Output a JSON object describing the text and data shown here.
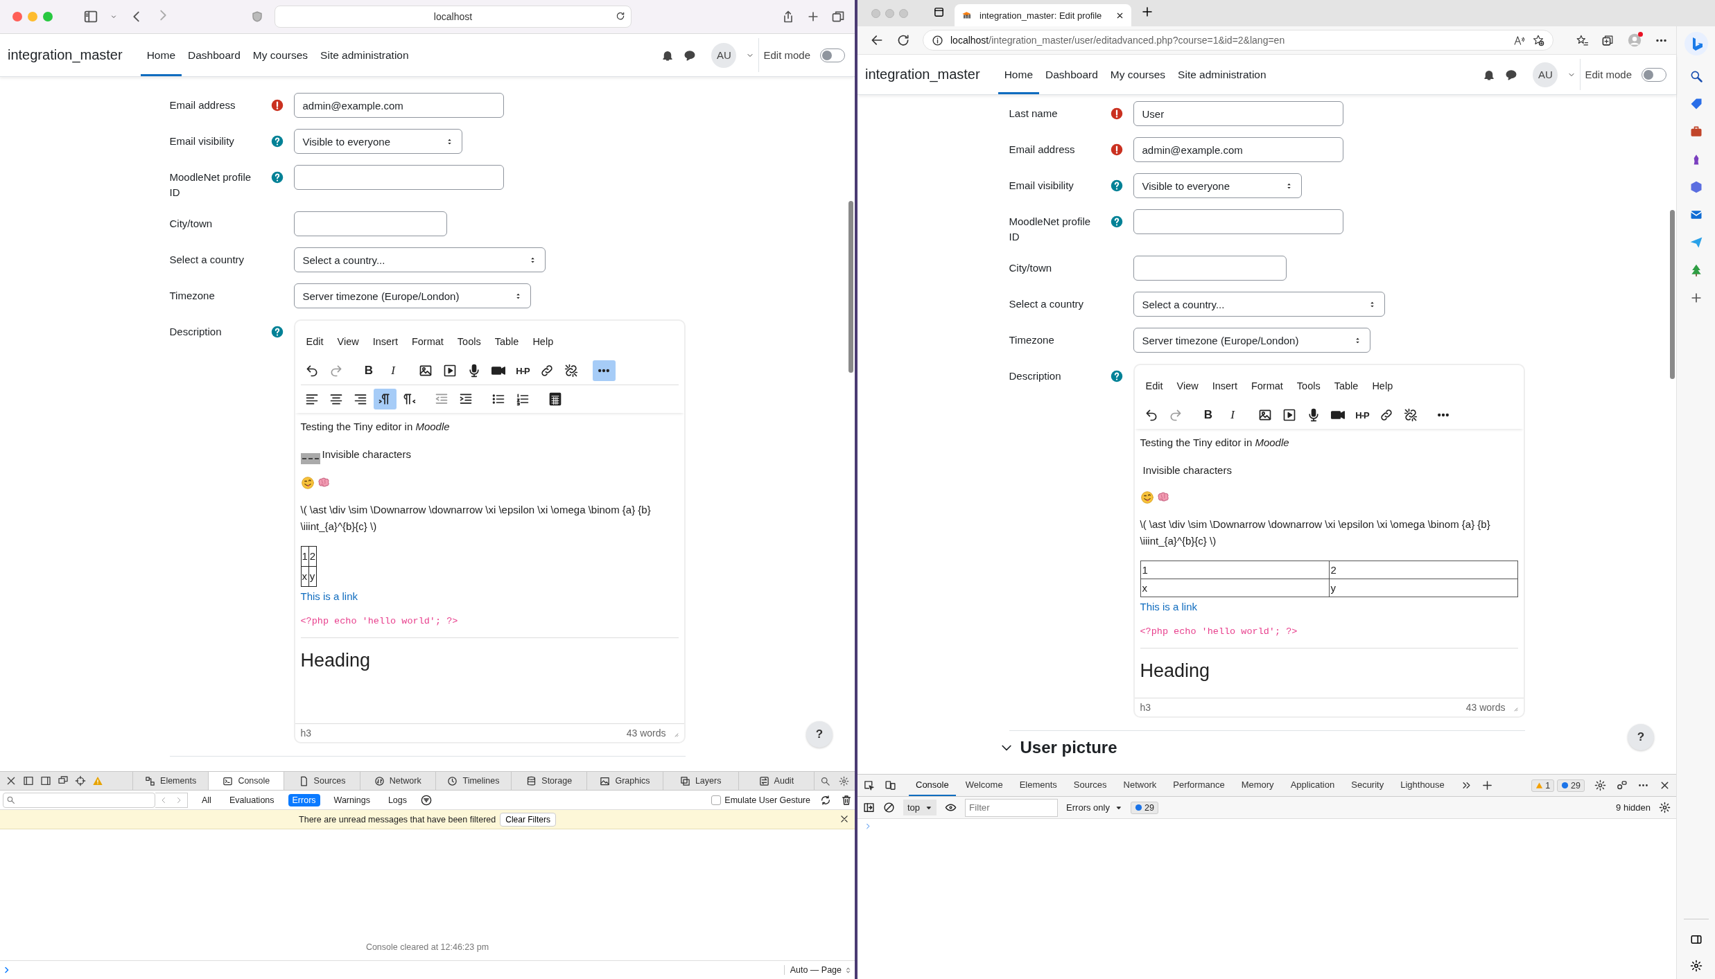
{
  "safari": {
    "address": "localhost",
    "page": {
      "brand": "integration_master",
      "nav": [
        {
          "label": "Home",
          "selected": true
        },
        {
          "label": "Dashboard",
          "selected": false
        },
        {
          "label": "My courses",
          "selected": false
        },
        {
          "label": "Site administration",
          "selected": false
        }
      ],
      "avatar": "AU",
      "edit_mode": {
        "label": "Edit mode",
        "on": false
      },
      "fields": [
        {
          "kind": "text",
          "label": "Email address",
          "required": true,
          "help": false,
          "value": "admin@example.com"
        },
        {
          "kind": "select",
          "label": "Email visibility",
          "required": false,
          "help": true,
          "value": "Visible to everyone"
        },
        {
          "kind": "text",
          "label": "MoodleNet profile ID",
          "required": false,
          "help": true
        },
        {
          "kind": "short-text",
          "label": "City/town",
          "required": false,
          "help": false
        },
        {
          "kind": "wide-select",
          "label": "Select a country",
          "required": false,
          "help": false,
          "value": "Select a country..."
        },
        {
          "kind": "select",
          "label": "Timezone",
          "required": false,
          "help": false,
          "value": "Server timezone (Europe/London)"
        },
        {
          "kind": "editor",
          "label": "Description",
          "required": false,
          "help": true
        }
      ],
      "editor": {
        "menu": [
          "Edit",
          "View",
          "Insert",
          "Format",
          "Tools",
          "Table",
          "Help"
        ],
        "toolbar_rows": [
          [
            {
              "kind": "undo",
              "selected": false,
              "disabled": false
            },
            {
              "kind": "redo",
              "selected": false,
              "disabled": true
            },
            {
              "kind": "bold",
              "label": "B",
              "selected": false,
              "disabled": false
            },
            {
              "kind": "italic",
              "label": "I",
              "selected": false,
              "disabled": false
            },
            {
              "kind": "image",
              "selected": false,
              "disabled": false
            },
            {
              "kind": "media",
              "selected": false,
              "disabled": false
            },
            {
              "kind": "record-audio",
              "selected": false,
              "disabled": false
            },
            {
              "kind": "record-video",
              "selected": false,
              "disabled": false
            },
            {
              "kind": "h5p",
              "label": "H-P",
              "selected": false,
              "disabled": false
            },
            {
              "kind": "link",
              "selected": false,
              "disabled": false
            },
            {
              "kind": "unlink",
              "selected": false,
              "disabled": false
            },
            {
              "kind": "more",
              "selected": true,
              "disabled": false
            }
          ],
          [
            {
              "kind": "align-left",
              "selected": false,
              "disabled": false
            },
            {
              "kind": "align-center",
              "selected": false,
              "disabled": false
            },
            {
              "kind": "align-right",
              "selected": false,
              "disabled": false
            },
            {
              "kind": "ltr",
              "selected": true,
              "disabled": false
            },
            {
              "kind": "rtl",
              "selected": false,
              "disabled": false
            },
            {
              "kind": "outdent",
              "selected": false,
              "disabled": true
            },
            {
              "kind": "indent",
              "selected": false,
              "disabled": false
            },
            {
              "kind": "bullet-list",
              "selected": false,
              "disabled": false
            },
            {
              "kind": "number-list",
              "selected": false,
              "disabled": false
            },
            {
              "kind": "calculator",
              "selected": false,
              "disabled": false
            }
          ]
        ],
        "content": [
          {
            "kind": "p",
            "text": "Testing the Tiny editor in *Moodle*"
          },
          {
            "kind": "p",
            "text": "Invisible characters",
            "nbsp_shown": true
          },
          {
            "kind": "emoji"
          },
          {
            "kind": "p",
            "text": "\\( \\ast \\div \\sim \\Downarrow \\downarrow \\xi \\epsilon \\xi \\omega \\binom {a} {b} \\iiint_{a}^{b}{c} \\)"
          },
          {
            "kind": "table",
            "full_width": false,
            "rows": [
              [
                "1",
                "2"
              ],
              [
                "x",
                "y"
              ]
            ]
          },
          {
            "kind": "link",
            "text": "This is a link"
          },
          {
            "kind": "code",
            "text": "<?php echo 'hello world'; ?>"
          },
          {
            "kind": "hr"
          },
          {
            "kind": "h3",
            "text": "Heading"
          }
        ],
        "path": "h3",
        "words": "43 words"
      },
      "help_button": "?"
    },
    "devtools": {
      "tabs": [
        {
          "label": "Elements",
          "selected": false
        },
        {
          "label": "Console",
          "selected": true
        },
        {
          "label": "Sources",
          "selected": false
        },
        {
          "label": "Network",
          "selected": false
        },
        {
          "label": "Timelines",
          "selected": false
        },
        {
          "label": "Storage",
          "selected": false
        },
        {
          "label": "Graphics",
          "selected": false
        },
        {
          "label": "Layers",
          "selected": false
        },
        {
          "label": "Audit",
          "selected": false
        }
      ],
      "filters": [
        {
          "label": "All",
          "selected": false
        },
        {
          "label": "Evaluations",
          "selected": false
        },
        {
          "label": "Errors",
          "selected": true
        },
        {
          "label": "Warnings",
          "selected": false
        },
        {
          "label": "Logs",
          "selected": false
        }
      ],
      "emulate": {
        "label": "Emulate User Gesture",
        "checked": false
      },
      "banner": "There are unread messages that have been filtered",
      "clear_button": "Clear Filters",
      "cleared": "Console cleared at 12:46:23 pm",
      "mode": "Auto — Page"
    }
  },
  "edge": {
    "tab_title": "integration_master: Edit profile",
    "url_host": "localhost",
    "url_path": "/integration_master/user/editadvanced.php?course=1&id=2&lang=en",
    "page": {
      "brand": "integration_master",
      "nav": [
        {
          "label": "Home",
          "selected": true
        },
        {
          "label": "Dashboard",
          "selected": false
        },
        {
          "label": "My courses",
          "selected": false
        },
        {
          "label": "Site administration",
          "selected": false
        }
      ],
      "avatar": "AU",
      "edit_mode": {
        "label": "Edit mode",
        "on": false
      },
      "fields": [
        {
          "kind": "text",
          "label": "Last name",
          "required": true,
          "help": false,
          "value": "User"
        },
        {
          "kind": "text",
          "label": "Email address",
          "required": true,
          "help": false,
          "value": "admin@example.com"
        },
        {
          "kind": "select",
          "label": "Email visibility",
          "required": false,
          "help": true,
          "value": "Visible to everyone"
        },
        {
          "kind": "text",
          "label": "MoodleNet profile ID",
          "required": false,
          "help": true
        },
        {
          "kind": "short-text",
          "label": "City/town",
          "required": false,
          "help": false
        },
        {
          "kind": "wide-select",
          "label": "Select a country",
          "required": false,
          "help": false,
          "value": "Select a country..."
        },
        {
          "kind": "select",
          "label": "Timezone",
          "required": false,
          "help": false,
          "value": "Server timezone (Europe/London)"
        },
        {
          "kind": "editor",
          "label": "Description",
          "required": false,
          "help": true
        }
      ],
      "editor": {
        "menu": [
          "Edit",
          "View",
          "Insert",
          "Format",
          "Tools",
          "Table",
          "Help"
        ],
        "toolbar_rows": [
          [
            {
              "kind": "undo",
              "selected": false,
              "disabled": false
            },
            {
              "kind": "redo",
              "selected": false,
              "disabled": true
            },
            {
              "kind": "bold",
              "label": "B",
              "selected": false,
              "disabled": false
            },
            {
              "kind": "italic",
              "label": "I",
              "selected": false,
              "disabled": false
            },
            {
              "kind": "image",
              "selected": false,
              "disabled": false
            },
            {
              "kind": "media",
              "selected": false,
              "disabled": false
            },
            {
              "kind": "record-audio",
              "selected": false,
              "disabled": false
            },
            {
              "kind": "record-video",
              "selected": false,
              "disabled": false
            },
            {
              "kind": "h5p",
              "label": "H-P",
              "selected": false,
              "disabled": false
            },
            {
              "kind": "link",
              "selected": false,
              "disabled": false
            },
            {
              "kind": "unlink",
              "selected": false,
              "disabled": false
            },
            {
              "kind": "more",
              "selected": false,
              "disabled": false
            }
          ]
        ],
        "content": [
          {
            "kind": "p",
            "text": "Testing the Tiny editor in *Moodle*"
          },
          {
            "kind": "p",
            "text": "Invisible characters",
            "nbsp_shown": false
          },
          {
            "kind": "emoji"
          },
          {
            "kind": "p",
            "text": "\\( \\ast \\div \\sim \\Downarrow \\downarrow \\xi \\epsilon \\xi \\omega \\binom {a} {b} \\iiint_{a}^{b}{c} \\)"
          },
          {
            "kind": "table",
            "full_width": true,
            "rows": [
              [
                "1",
                "2"
              ],
              [
                "x",
                "y"
              ]
            ]
          },
          {
            "kind": "link",
            "text": "This is a link"
          },
          {
            "kind": "code",
            "text": "<?php echo 'hello world'; ?>"
          },
          {
            "kind": "hr"
          },
          {
            "kind": "h3",
            "text": "Heading"
          }
        ],
        "path": "h3",
        "words": "43 words"
      },
      "section": {
        "title": "User picture",
        "expanded": true
      },
      "help_button": "?"
    },
    "devtools": {
      "tabs": [
        {
          "label": "Console",
          "selected": true
        },
        {
          "label": "Welcome",
          "selected": false
        },
        {
          "label": "Elements",
          "selected": false
        },
        {
          "label": "Sources",
          "selected": false
        },
        {
          "label": "Network",
          "selected": false
        },
        {
          "label": "Performance",
          "selected": false
        },
        {
          "label": "Memory",
          "selected": false
        },
        {
          "label": "Application",
          "selected": false
        },
        {
          "label": "Security",
          "selected": false
        },
        {
          "label": "Lighthouse",
          "selected": false
        }
      ],
      "warnings": "1",
      "messages": "29",
      "context": "top",
      "filter_placeholder": "Filter",
      "level": "Errors only",
      "level_count": "29",
      "hidden": "9 hidden"
    }
  }
}
